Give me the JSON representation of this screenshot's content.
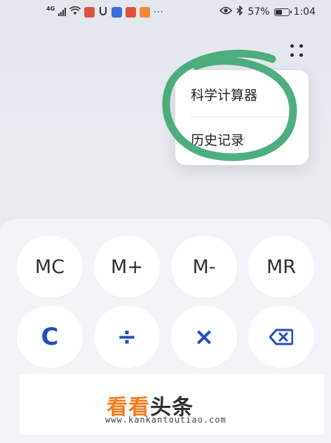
{
  "status_bar": {
    "network_type": "4G",
    "battery_percent": "57%",
    "battery_level": 0.57,
    "time": "1:04",
    "overflow_dots": "···"
  },
  "menu": {
    "items": [
      {
        "label": "科学计算器"
      },
      {
        "label": "历史记录"
      }
    ],
    "highlight_color": "#3fa774"
  },
  "keypad": {
    "row1": [
      {
        "label": "MC"
      },
      {
        "label": "M+"
      },
      {
        "label": "M-"
      },
      {
        "label": "MR"
      }
    ],
    "row2": [
      {
        "label": "C"
      },
      {
        "label": "÷"
      },
      {
        "label": "×"
      },
      {
        "label": "⌫"
      }
    ],
    "accent_color": "#1e4fbf"
  },
  "watermark": {
    "logo_part1": "看看",
    "logo_part2": "头条",
    "url": "www.kankantoutiao.com"
  }
}
